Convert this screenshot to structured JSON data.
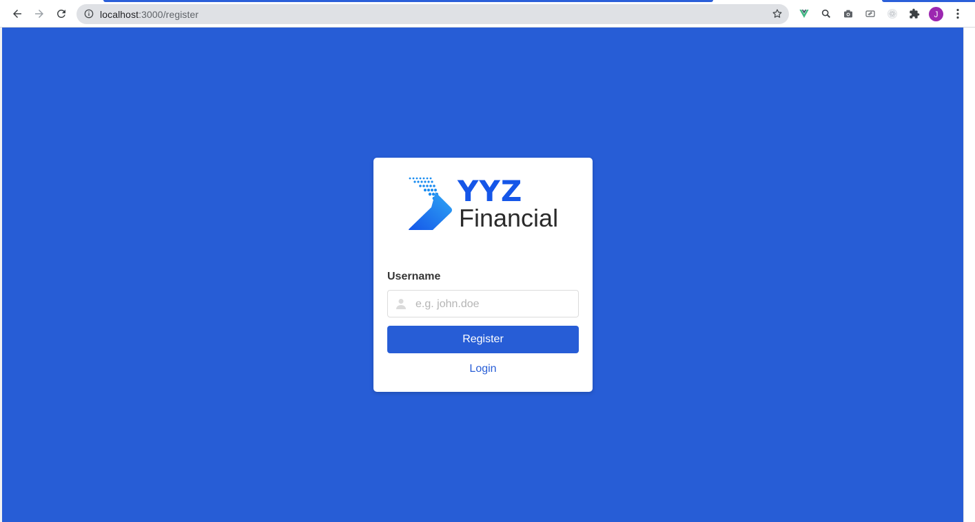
{
  "browser": {
    "url_host": "localhost",
    "url_rest": ":3000/register",
    "profile_initial": "J",
    "accent_color": "#275dd6"
  },
  "card": {
    "logo": {
      "line1": "YYZ",
      "line2": "Financial"
    },
    "username_label": "Username",
    "username_placeholder": "e.g. john.doe",
    "register_label": "Register",
    "login_label": "Login"
  }
}
